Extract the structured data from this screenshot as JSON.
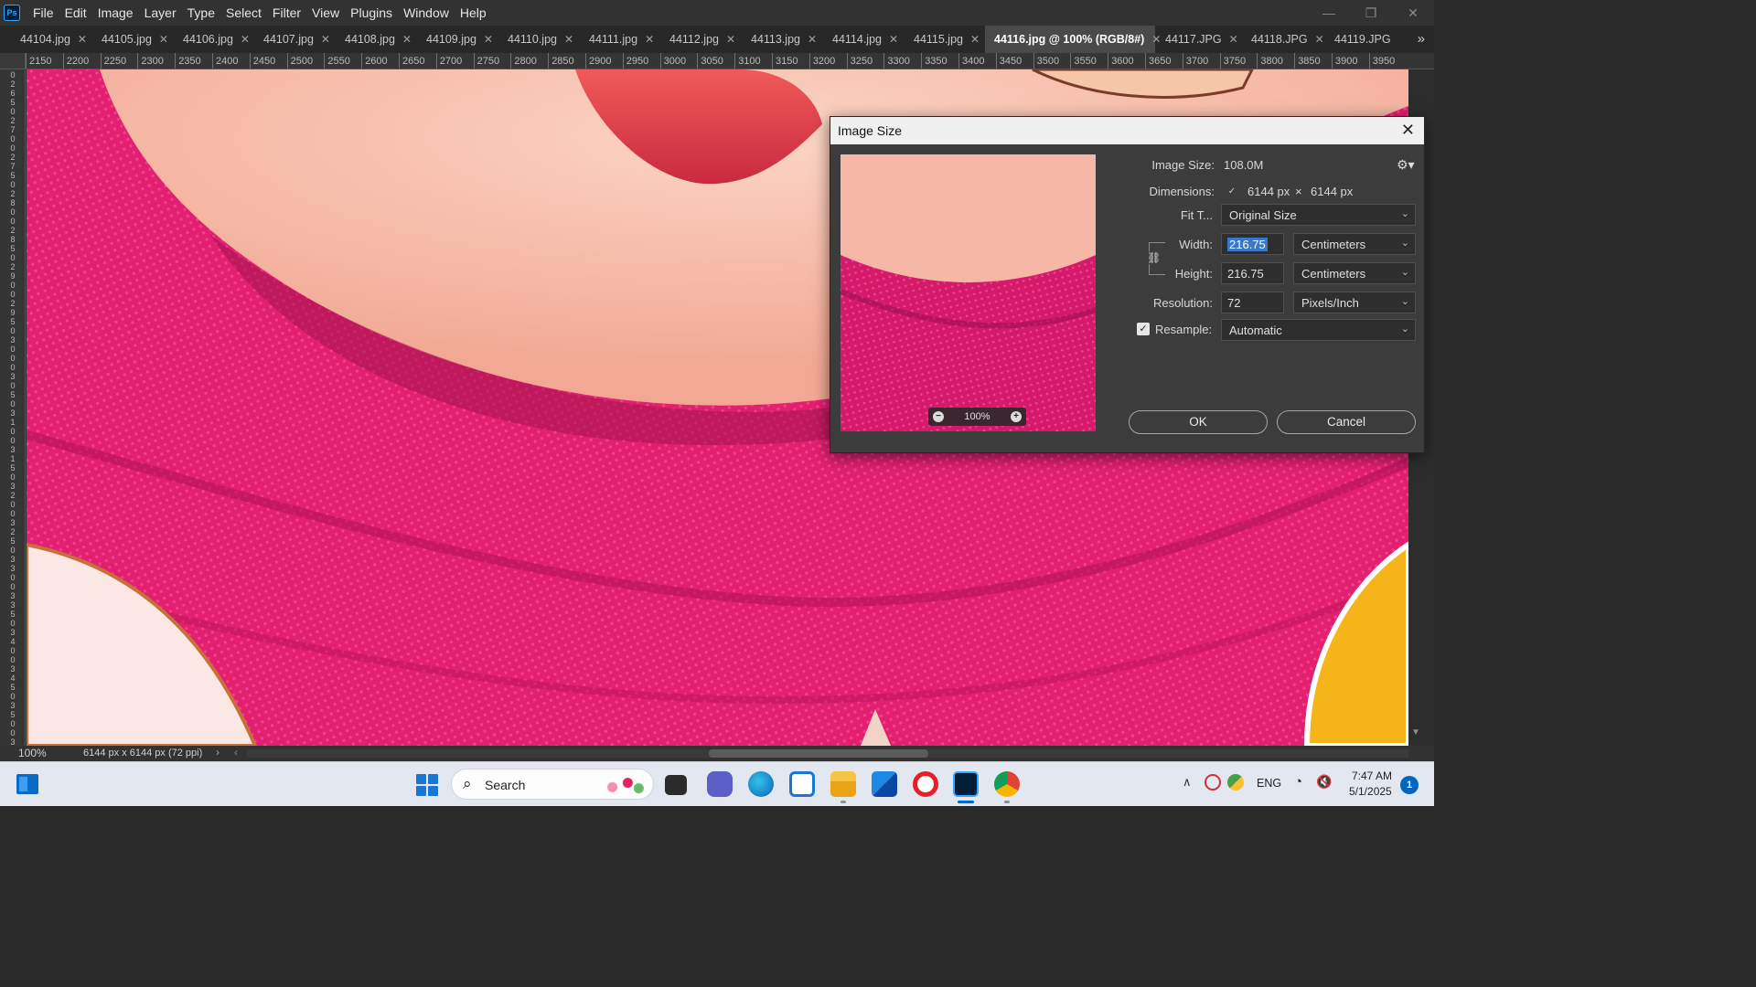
{
  "app": {
    "logo": "Ps",
    "colors": {
      "accent": "#31a8ff",
      "canvas_pink": "#e51f77"
    }
  },
  "menu": [
    "File",
    "Edit",
    "Image",
    "Layer",
    "Type",
    "Select",
    "Filter",
    "View",
    "Plugins",
    "Window",
    "Help"
  ],
  "window_controls": {
    "minimize": "—",
    "restore": "❐",
    "close": "✕"
  },
  "tabs": [
    {
      "label": "44104.jpg"
    },
    {
      "label": "44105.jpg"
    },
    {
      "label": "44106.jpg"
    },
    {
      "label": "44107.jpg"
    },
    {
      "label": "44108.jpg"
    },
    {
      "label": "44109.jpg"
    },
    {
      "label": "44110.jpg"
    },
    {
      "label": "44111.jpg"
    },
    {
      "label": "44112.jpg"
    },
    {
      "label": "44113.jpg"
    },
    {
      "label": "44114.jpg"
    },
    {
      "label": "44115.jpg"
    },
    {
      "label": "44116.jpg @ 100% (RGB/8#)",
      "active": true
    },
    {
      "label": "44117.JPG"
    },
    {
      "label": "44118.JPG"
    },
    {
      "label": "44119.JPG"
    }
  ],
  "ruler_h": [
    "2150",
    "2200",
    "2250",
    "2300",
    "2350",
    "2400",
    "2450",
    "2500",
    "2550",
    "2600",
    "2650",
    "2700",
    "2750",
    "2800",
    "2850",
    "2900",
    "2950",
    "3000",
    "3050",
    "3100",
    "3150",
    "3200",
    "3250",
    "3300",
    "3350",
    "3400",
    "3450",
    "3500",
    "3550",
    "3600",
    "3650",
    "3700",
    "3750",
    "3800",
    "3850",
    "3900",
    "3950"
  ],
  "ruler_v": [
    "0",
    "2",
    "6",
    "5",
    "0",
    "2",
    "7",
    "0",
    "0",
    "2",
    "7",
    "5",
    "0",
    "2",
    "8",
    "0",
    "0",
    "2",
    "8",
    "5",
    "0",
    "2",
    "9",
    "0",
    "0",
    "2",
    "9",
    "5",
    "0",
    "3",
    "0",
    "0",
    "0",
    "3",
    "0",
    "5",
    "0",
    "3",
    "1",
    "0",
    "0",
    "3",
    "1",
    "5",
    "0",
    "3",
    "2",
    "0",
    "0",
    "3",
    "2",
    "5",
    "0",
    "3",
    "3",
    "0",
    "0",
    "3",
    "3",
    "5",
    "0",
    "3",
    "4",
    "0",
    "0",
    "3",
    "4",
    "5",
    "0",
    "3",
    "5",
    "0",
    "0",
    "3",
    "5",
    "5"
  ],
  "status": {
    "zoom": "100%",
    "doc_info": "6144 px x 6144 px (72 ppi)"
  },
  "dialog": {
    "title": "Image Size",
    "image_size_label": "Image Size:",
    "image_size_value": "108.0M",
    "dimensions_label": "Dimensions:",
    "dim_w": "6144 px",
    "dim_x": "×",
    "dim_h": "6144 px",
    "fit_to_label": "Fit T...",
    "fit_to_value": "Original Size",
    "width_label": "Width:",
    "width_value": "216.75",
    "width_unit": "Centimeters",
    "height_label": "Height:",
    "height_value": "216.75",
    "height_unit": "Centimeters",
    "resolution_label": "Resolution:",
    "resolution_value": "72",
    "resolution_unit": "Pixels/Inch",
    "resample_label": "Resample:",
    "resample_checked": true,
    "resample_value": "Automatic",
    "preview_zoom": "100%",
    "ok_label": "OK",
    "cancel_label": "Cancel"
  },
  "taskbar": {
    "search_label": "Search",
    "apps": [
      "widgets-icon",
      "start-icon",
      "task-view-icon",
      "teams-icon",
      "edge-icon",
      "snipping-tool-icon",
      "file-explorer-icon",
      "store-icon",
      "opera-icon",
      "photoshop-icon",
      "chrome-icon"
    ],
    "tray_lang": "ENG",
    "time": "7:47 AM",
    "date": "5/1/2025",
    "notification_count": "1"
  }
}
